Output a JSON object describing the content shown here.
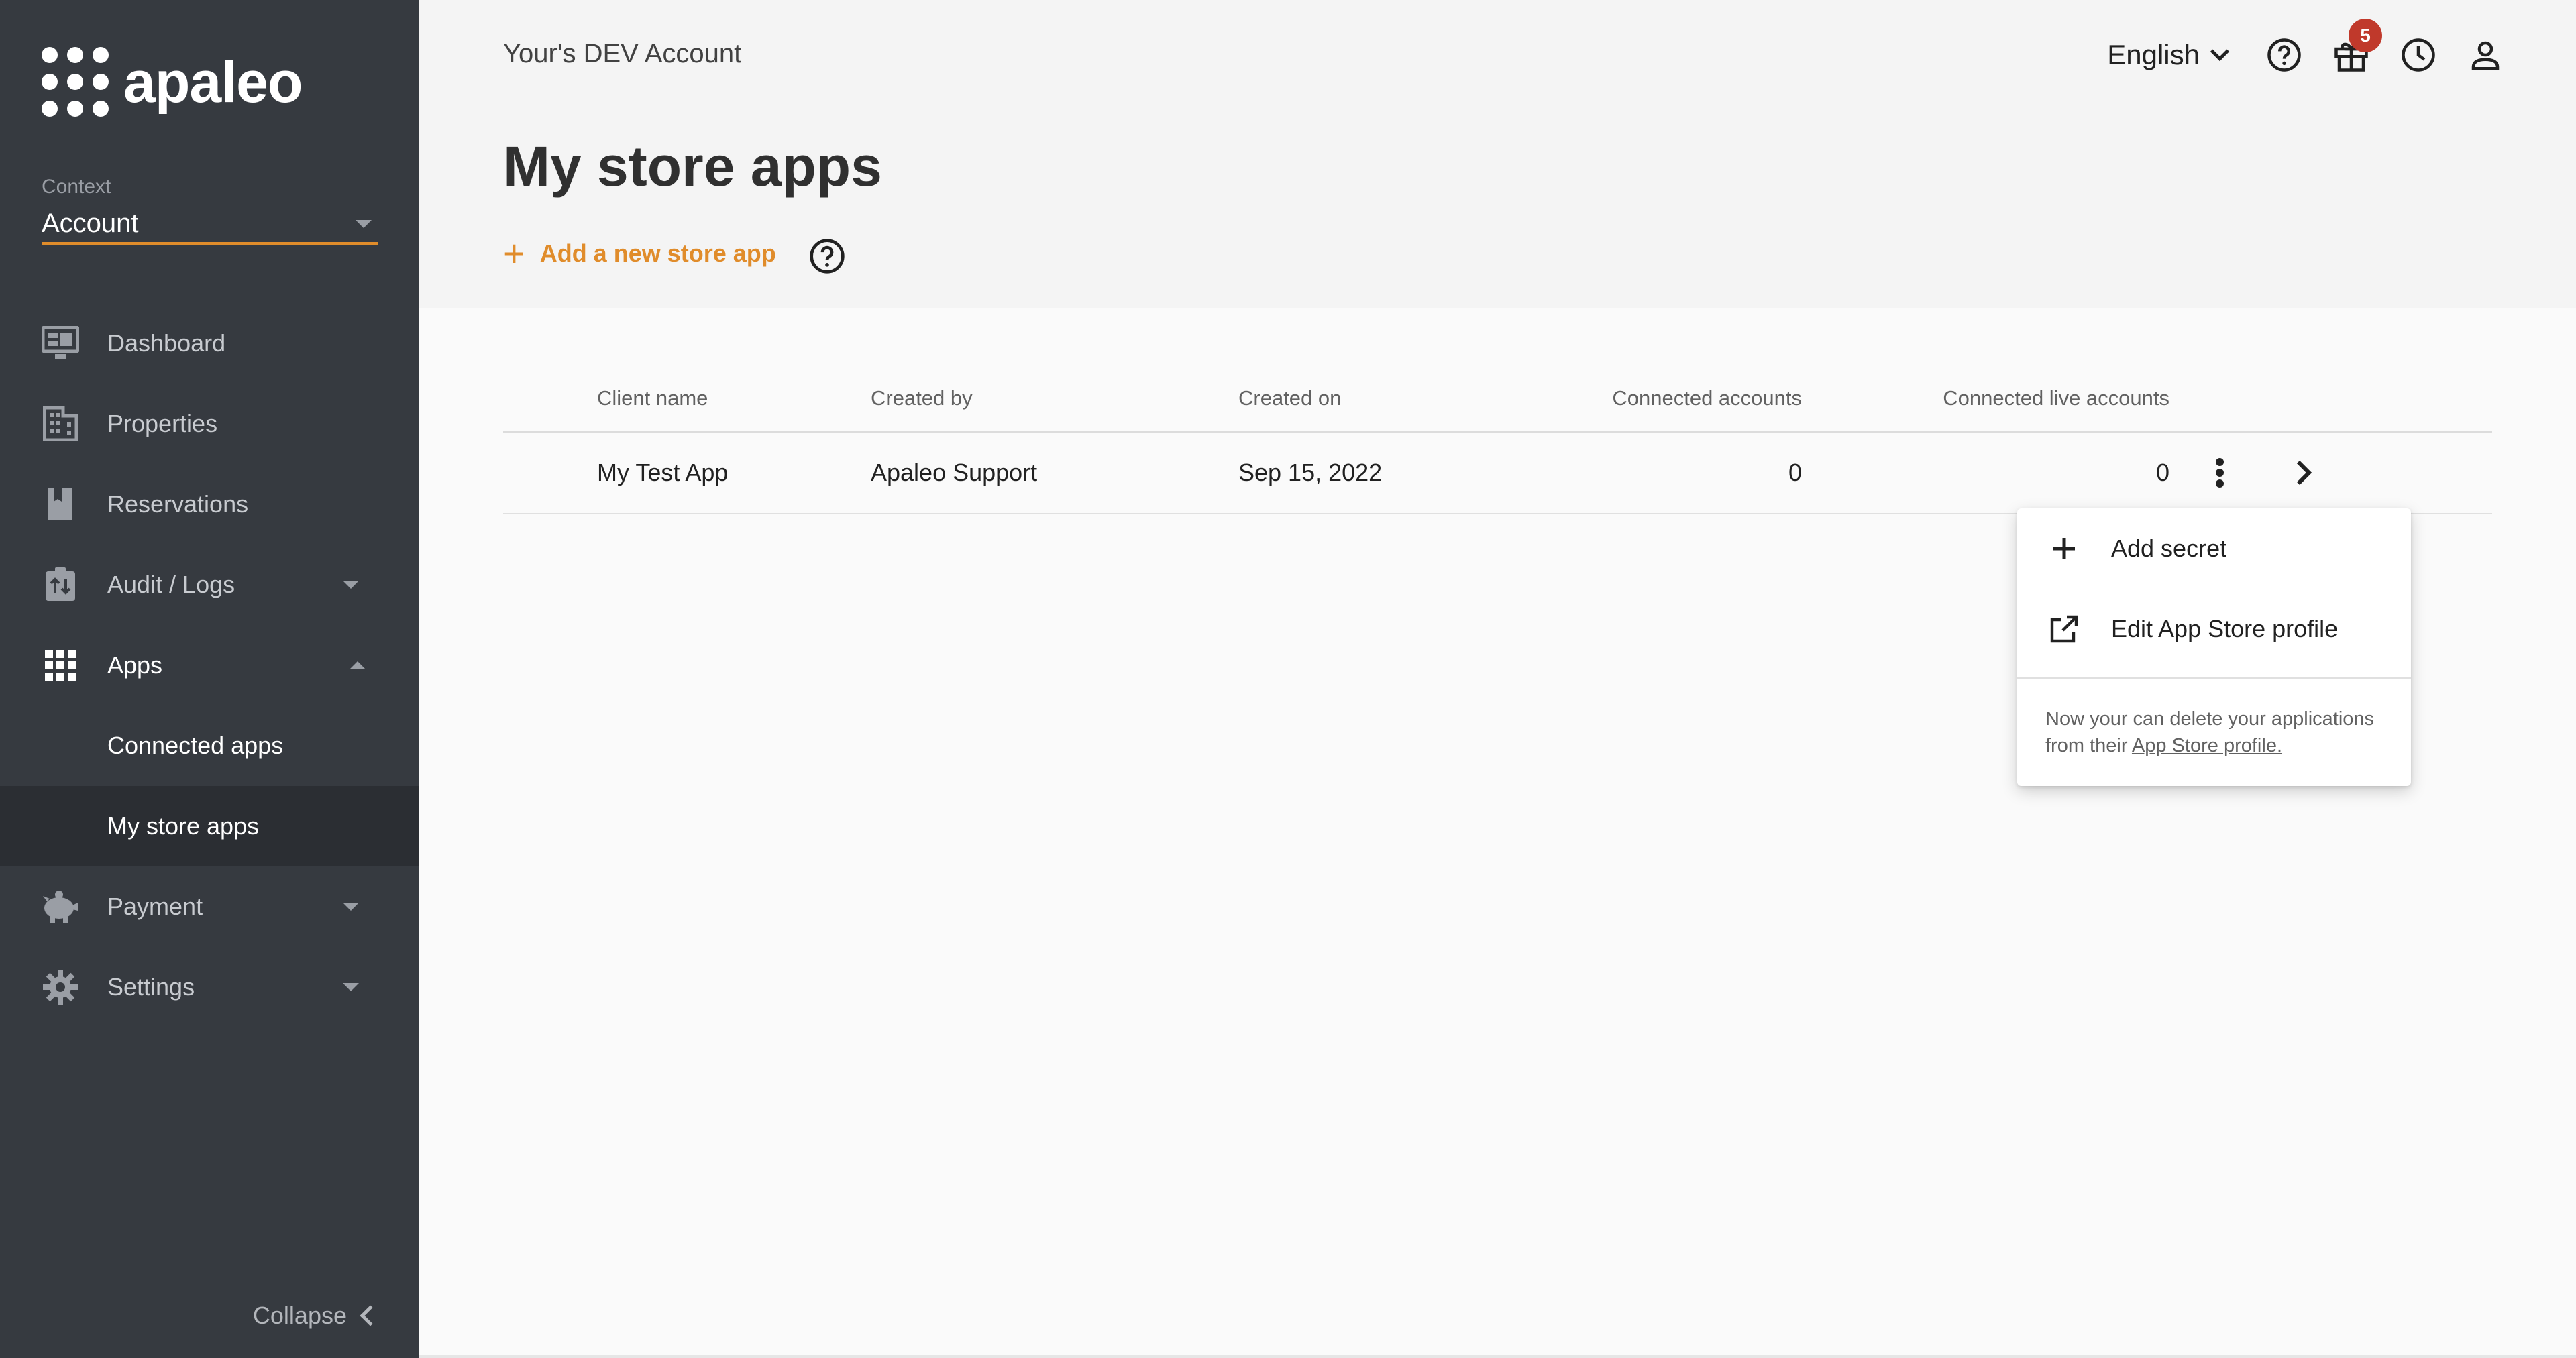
{
  "brand": {
    "name": "apaleo",
    "accent": "#e08c2b"
  },
  "context": {
    "label": "Context",
    "value": "Account"
  },
  "nav": {
    "dashboard": "Dashboard",
    "properties": "Properties",
    "reservations": "Reservations",
    "audit": "Audit / Logs",
    "apps": "Apps",
    "apps_sub": {
      "connected": "Connected apps",
      "store": "My store apps"
    },
    "payment": "Payment",
    "settings": "Settings",
    "collapse": "Collapse"
  },
  "header": {
    "account": "Your's DEV Account",
    "language": "English",
    "notification_count": "5",
    "icons": [
      "help-icon",
      "gift-icon",
      "clock-icon",
      "user-icon"
    ]
  },
  "page": {
    "title": "My store apps",
    "add_label": "Add a new store app",
    "add_icon": "+"
  },
  "table": {
    "columns": [
      "Client name",
      "Created by",
      "Created on",
      "Connected accounts",
      "Connected live accounts"
    ],
    "rows": [
      {
        "client": "My Test App",
        "created_by": "Apaleo Support",
        "created_on": "Sep 15, 2022",
        "connected": "0",
        "live": "0"
      }
    ]
  },
  "menu": {
    "add_secret": "Add secret",
    "edit_profile": "Edit App Store profile",
    "note_text": "Now your can delete your applications from their ",
    "note_link": "App Store profile."
  }
}
